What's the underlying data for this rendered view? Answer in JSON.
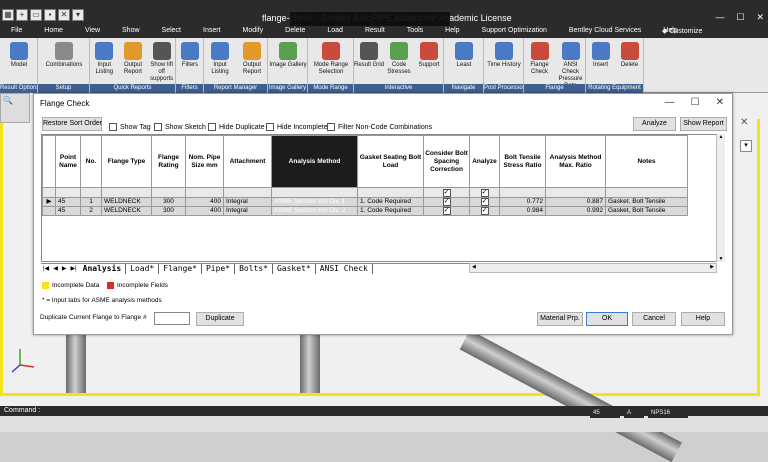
{
  "app": {
    "title": "flange-check - Bentley AutoPIPE Advanced: Academic License",
    "title_short": "flange-check",
    "title_rest": "Bentley AutoPIPE Advanced: Academic License",
    "customize": "Customize",
    "menu_tabs": [
      "File",
      "Home",
      "View",
      "Show",
      "Select",
      "Insert",
      "Modify",
      "Delete",
      "Load",
      "Result",
      "Tools",
      "Help",
      "Support Optimization",
      "Bentley Cloud Services",
      "Help"
    ]
  },
  "ribbon": {
    "groups": [
      {
        "caption": "Result Options",
        "buttons": [
          {
            "label": "Model",
            "icon": "model-icon",
            "color": "#4a79c5"
          }
        ]
      },
      {
        "caption": "Setup",
        "buttons": [
          {
            "label": "Combinations",
            "icon": "combinations-icon",
            "color": "#8a8a8a"
          }
        ]
      },
      {
        "caption": "Quick Reports",
        "buttons": [
          {
            "label": "Input Listing",
            "icon": "listing-icon",
            "color": "#4a79c5"
          },
          {
            "label": "Output Report",
            "icon": "report-icon",
            "color": "#e09a2a"
          },
          {
            "label": "Show lift off supports",
            "icon": "supports-icon",
            "color": "#555555"
          }
        ]
      },
      {
        "caption": "Filters",
        "buttons": [
          {
            "label": "Filters",
            "icon": "filter-icon",
            "color": "#4a79c5"
          }
        ]
      },
      {
        "caption": "Report Manager",
        "buttons": [
          {
            "label": "Input Listing",
            "icon": "listing-icon",
            "color": "#4a79c5"
          },
          {
            "label": "Output Report",
            "icon": "report-icon",
            "color": "#e09a2a"
          }
        ]
      },
      {
        "caption": "Image Gallery",
        "buttons": [
          {
            "label": "Image Gallery",
            "icon": "gallery-icon",
            "color": "#5a9e4f"
          }
        ]
      },
      {
        "caption": "Mode Range",
        "buttons": [
          {
            "label": "Mode Range Selection",
            "icon": "mode-range-icon",
            "color": "#c94b3d"
          }
        ]
      },
      {
        "caption": "Interactive",
        "buttons": [
          {
            "label": "Result Grid",
            "icon": "grid-icon",
            "color": "#555555"
          },
          {
            "label": "Code Stresses",
            "icon": "stress-icon",
            "color": "#5a9e4f"
          },
          {
            "label": "Support",
            "icon": "support-icon",
            "color": "#c94b3d"
          }
        ]
      },
      {
        "caption": "Navigate",
        "buttons": [
          {
            "label": "Least",
            "icon": "navigate-icon",
            "color": "#4a79c5"
          }
        ]
      },
      {
        "caption": "Post Processor",
        "buttons": [
          {
            "label": "Time History",
            "icon": "clock-icon",
            "color": "#4a79c5"
          }
        ]
      },
      {
        "caption": "Flange",
        "buttons": [
          {
            "label": "Flange Check",
            "icon": "flange-icon",
            "color": "#c94b3d"
          },
          {
            "label": "ANSI Check Pressure Data",
            "icon": "ansi-icon",
            "color": "#4a79c5"
          }
        ]
      },
      {
        "caption": "Rotating Equipment",
        "buttons": [
          {
            "label": "Insert",
            "icon": "insert-icon",
            "color": "#4a79c5"
          },
          {
            "label": "Delete",
            "icon": "delete-icon",
            "color": "#c94b3d"
          }
        ]
      }
    ]
  },
  "dialog": {
    "title": "Flange Check",
    "restore_sort_order": "Restore Sort Order",
    "analyze": "Analyze",
    "show_report": "Show Report",
    "checkboxes": [
      {
        "label": "Show Tag",
        "checked": false
      },
      {
        "label": "Show Sketch",
        "checked": false
      },
      {
        "label": "Hide Duplicate",
        "checked": false
      },
      {
        "label": "Hide Incomplete",
        "checked": false
      },
      {
        "label": "Filter Non-Code Combinations",
        "checked": false
      }
    ],
    "columns": [
      "",
      "Point Name",
      "No.",
      "Flange Type",
      "Flange Rating",
      "Nom. Pipe Size mm",
      "Attachment",
      "Analysis Method",
      "Gasket Seating Bolt Load",
      "Consider Bolt Spacing Correction",
      "Analyze",
      "Bolt Tensile Stress Ratio",
      "Analysis Method Max. Ratio",
      "Notes"
    ],
    "rows": [
      {
        "marker": "▶",
        "point": "45",
        "no": "1",
        "type": "WELDNECK",
        "rating": "300",
        "size": "400",
        "attachment": "Integral",
        "method": "ASME Section VIII Div. 1",
        "gasket": "1. Code Required",
        "spacing": true,
        "analyze": true,
        "bolt_ratio": "0.772",
        "max_ratio": "0.887",
        "notes": "Gasket, Bolt Tensile"
      },
      {
        "marker": "",
        "point": "45",
        "no": "2",
        "type": "WELDNECK",
        "rating": "300",
        "size": "400",
        "attachment": "Integral",
        "method": "ASME Section VIII Div. 2",
        "gasket": "1. Code Required",
        "spacing": true,
        "analyze": true,
        "bolt_ratio": "0.984",
        "max_ratio": "0.992",
        "notes": "Gasket, Bolt Tensile"
      }
    ],
    "sheet_tabs": [
      "Analysis",
      "Load*",
      "Flange*",
      "Pipe*",
      "Bolts*",
      "Gasket*",
      "ANSI Check"
    ],
    "legend_incomplete_data": "Incomplete Data",
    "legend_incomplete_fields": "Incomplete Fields",
    "legend_note": "* = Input tabs for ASME analysis methods",
    "duplicate_label": "Duplicate Current Flange to Flange #",
    "duplicate_button": "Duplicate",
    "material_prp": "Material Prp.",
    "ok": "OK",
    "cancel": "Cancel",
    "help": "Help"
  },
  "colors": {
    "incomplete_data": "#f2e31a",
    "incomplete_fields": "#d62b2b",
    "ribbon_caption": "#3f5f8f",
    "viewport_border": "#f2e31a"
  },
  "status": {
    "command_label": "Command :",
    "point": "45",
    "flag": "A",
    "nps": "NPS16"
  }
}
